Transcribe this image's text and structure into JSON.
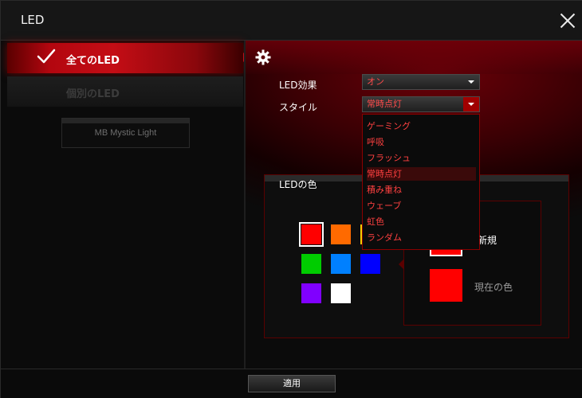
{
  "window": {
    "title": "LED"
  },
  "sidebar": {
    "items": [
      {
        "label": "全てのLED",
        "active": true
      },
      {
        "label": "個別のLED",
        "active": false
      }
    ],
    "device": "MB Mystic Light"
  },
  "settings": {
    "effect_label": "LED効果",
    "effect_value": "オン",
    "style_label": "スタイル",
    "style_value": "常時点灯",
    "style_options": [
      "ゲーミング",
      "呼吸",
      "フラッシュ",
      "常時点灯",
      "積み重ね",
      "ウェーブ",
      "虹色",
      "ランダム"
    ],
    "style_selected_index": 3
  },
  "led_color": {
    "title": "LEDの色",
    "swatches": [
      "#ff0000",
      "#ff6a00",
      "#ffcc00",
      "#00cc00",
      "#0080ff",
      "#0000ff",
      "#8000ff",
      "#ffffff"
    ],
    "selected_swatch_index": 0,
    "new_label": "新規",
    "current_label": "現在の色",
    "new_color": "#ff0000",
    "current_color": "#ff0000"
  },
  "footer": {
    "apply_label": "適用"
  },
  "colors": {
    "accent": "#c40d15",
    "dropdown_text": "#ff4040"
  }
}
